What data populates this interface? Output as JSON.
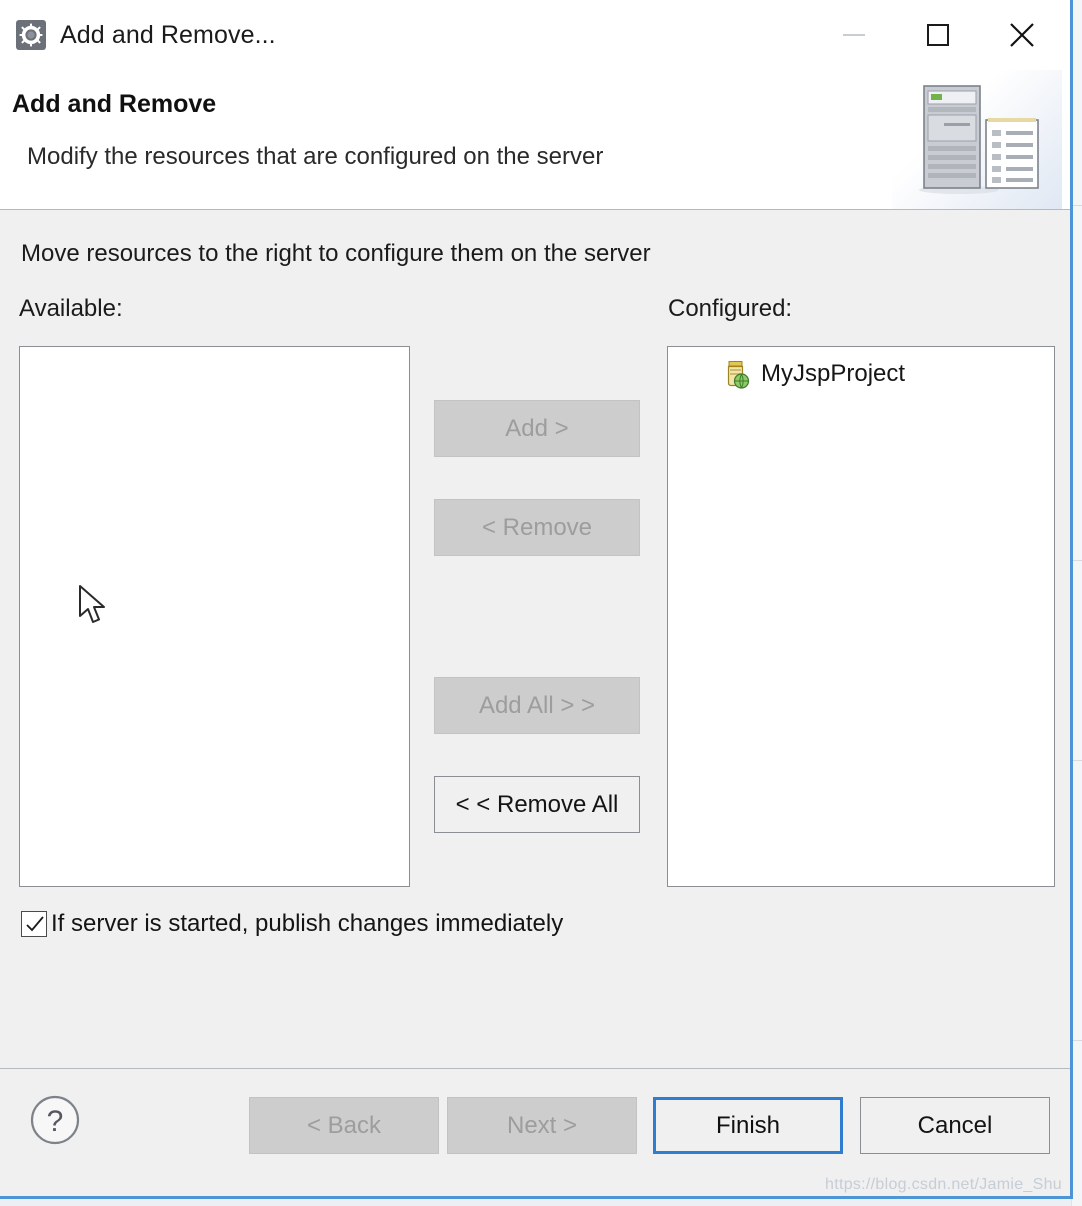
{
  "window": {
    "title": "Add and Remove...",
    "title_icon": "gear-icon",
    "controls": {
      "minimize": "minimize-icon",
      "maximize": "maximize-icon",
      "close": "close-icon"
    }
  },
  "header": {
    "title": "Add and Remove",
    "subtitle": "Modify the resources that are configured on the server",
    "banner_icon": "server-and-document-icon"
  },
  "body": {
    "instruction": "Move resources to the right to configure them on the server",
    "available": {
      "label": "Available:",
      "items": []
    },
    "configured": {
      "label": "Configured:",
      "items": [
        {
          "name": "MyJspProject",
          "icon": "jar-module-icon"
        }
      ]
    },
    "transfer_buttons": [
      {
        "label": "Add >",
        "enabled": false
      },
      {
        "label": "< Remove",
        "enabled": false
      },
      {
        "label": "Add All > >",
        "enabled": false
      },
      {
        "label": "< < Remove All",
        "enabled": true
      }
    ],
    "publish_checkbox": {
      "label": "If server is started, publish changes immediately",
      "checked": true
    }
  },
  "footer": {
    "help": "?",
    "buttons": [
      {
        "label": "< Back",
        "enabled": false,
        "focused": false
      },
      {
        "label": "Next >",
        "enabled": false,
        "focused": false
      },
      {
        "label": "Finish",
        "enabled": true,
        "focused": true
      },
      {
        "label": "Cancel",
        "enabled": true,
        "focused": false
      }
    ]
  },
  "watermark": "https://blog.csdn.net/Jamie_Shu",
  "colors": {
    "dialog_border": "#4d95d6",
    "focus_border": "#2f7dd1",
    "body_bg": "#f0f0f0",
    "disabled_bg": "#cdcdcd",
    "disabled_text": "#9d9d9d",
    "text": "#141414"
  }
}
